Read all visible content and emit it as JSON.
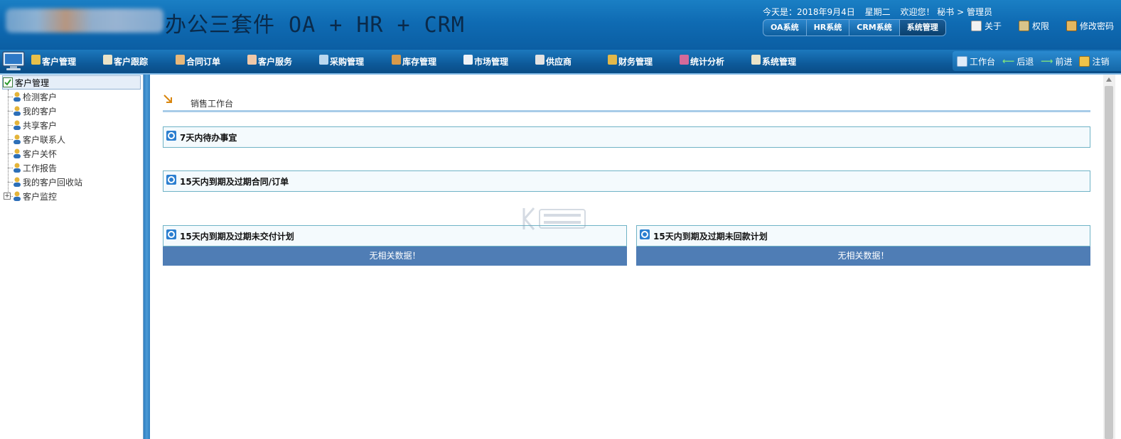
{
  "header": {
    "app_title": "办公三套件 OA + HR + CRM",
    "date_prefix": "今天是：2018年9月4日",
    "weekday": "星期二",
    "welcome": "欢迎您！ 秘书 > 管理员",
    "system_tabs": [
      "OA系统",
      "HR系统",
      "CRM系统",
      "系统管理"
    ],
    "links": {
      "about": "关于",
      "permission": "权限",
      "change_password": "修改密码"
    }
  },
  "nav": {
    "items": [
      "客户管理",
      "客户跟踪",
      "合同订单",
      "客户服务",
      "采购管理",
      "库存管理",
      "市场管理",
      "供应商",
      "财务管理",
      "统计分析",
      "系统管理"
    ],
    "right": {
      "workbench": "工作台",
      "back": "后退",
      "forward": "前进",
      "logout": "注销"
    }
  },
  "sidebar": {
    "header": "客户管理",
    "items": [
      "检测客户",
      "我的客户",
      "共享客户",
      "客户联系人",
      "客户关怀",
      "工作报告",
      "我的客户回收站",
      "客户监控"
    ]
  },
  "main": {
    "title": "销售工作台",
    "panels": {
      "todo_7days": "7天内待办事宜",
      "expiring_contracts": "15天内到期及过期合同/订单",
      "delivery_plan": "15天内到期及过期未交付计划",
      "payment_plan": "15天内到期及过期未回款计划"
    },
    "no_data": "无相关数据！"
  },
  "colors": {
    "header_blue": "#0f6bb3",
    "nodata_bg": "#4f7db5",
    "panel_border": "#6fb3c6"
  }
}
